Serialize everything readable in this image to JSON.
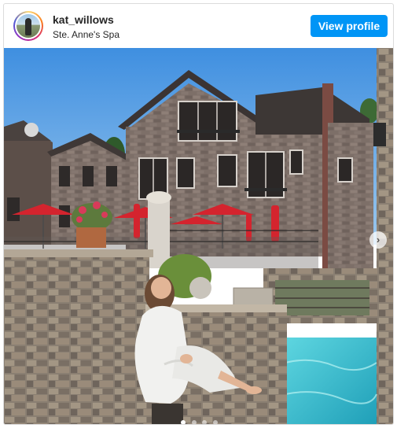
{
  "post": {
    "username": "kat_willows",
    "location": "Ste. Anne's Spa",
    "view_profile_label": "View profile",
    "carousel": {
      "slide_count": 4,
      "active_index": 0
    }
  },
  "icons": {
    "next": "chevron-right-icon"
  },
  "colors": {
    "button": "#0095f6",
    "text": "#262626",
    "border": "#dbdbdb"
  }
}
